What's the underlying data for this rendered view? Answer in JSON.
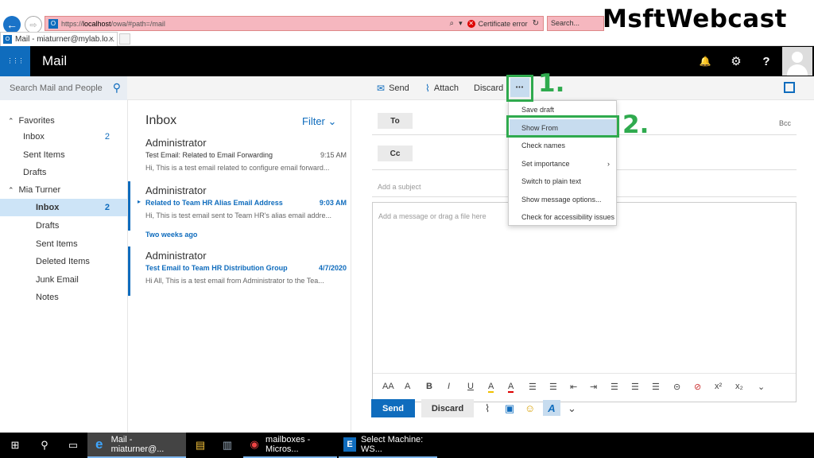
{
  "browser": {
    "back_glyph": "←",
    "fwd_glyph": "⇨",
    "url_prefix": "https://",
    "url_host": "localhost",
    "url_path": "/owa/#path=/mail",
    "search_icon_glyph": "⌕",
    "dropdown_glyph": "▾",
    "cert_glyph": "✕",
    "cert_error": "Certificate error",
    "refresh_glyph": "↻",
    "search_placeholder": "Search...",
    "tab_title": "Mail - miaturner@mylab.lo...",
    "tab_close_glyph": "×",
    "favicon_glyph": "O",
    "brand": "MsftWebcast"
  },
  "header": {
    "waffle_glyph": "⋮⋮⋮",
    "app_name": "Mail",
    "bell_glyph": "🔔",
    "gear_glyph": "⚙",
    "help_glyph": "?"
  },
  "toolbar": {
    "search_placeholder": "Search Mail and People",
    "search_glyph": "⚲",
    "send_glyph": "✉",
    "send": "Send",
    "attach_glyph": "⌇",
    "attach": "Attach",
    "discard": "Discard",
    "more_glyph": "•••"
  },
  "folders": {
    "caret": "⌃",
    "favorites_label": "Favorites",
    "favorites": [
      {
        "label": "Inbox",
        "count": "2"
      },
      {
        "label": "Sent Items",
        "count": ""
      },
      {
        "label": "Drafts",
        "count": ""
      }
    ],
    "account_label": "Mia Turner",
    "account": [
      {
        "label": "Inbox",
        "count": "2"
      },
      {
        "label": "Drafts",
        "count": ""
      },
      {
        "label": "Sent Items",
        "count": ""
      },
      {
        "label": "Deleted Items",
        "count": ""
      },
      {
        "label": "Junk Email",
        "count": ""
      },
      {
        "label": "Notes",
        "count": ""
      }
    ]
  },
  "message_list": {
    "title": "Inbox",
    "filter": "Filter",
    "filter_glyph": "⌄",
    "group_label": "Two weeks ago",
    "unread_glyph": "▸",
    "messages": [
      {
        "from": "Administrator",
        "subject": "Test Email: Related to Email Forwarding",
        "time": "9:15 AM",
        "preview": "Hi, This is a test email related to configure email forward..."
      },
      {
        "from": "Administrator",
        "subject": "Related to Team HR Alias Email Address",
        "time": "9:03 AM",
        "preview": "Hi, This is test email sent to Team HR's alias email addre..."
      },
      {
        "from": "Administrator",
        "subject": "Test Email to Team HR Distribution Group",
        "time": "4/7/2020",
        "preview": "Hi All, This is a test email from Administrator to the Tea..."
      }
    ]
  },
  "compose": {
    "to": "To",
    "cc": "Cc",
    "bcc": "Bcc",
    "subject_placeholder": "Add a subject",
    "body_placeholder": "Add a message or drag a file here",
    "send": "Send",
    "discard": "Discard",
    "attach_glyph": "⌇",
    "image_glyph": "▣",
    "emoji_glyph": "☺",
    "format_glyph": "A",
    "more_glyph": "⌄",
    "format_tools": [
      "AA",
      "A",
      "B",
      "I",
      "U",
      "A",
      "A",
      "☰",
      "☰",
      "⇤",
      "⇥",
      "☰",
      "☰",
      "☰",
      "⊝",
      "⊘",
      "x²",
      "x₂",
      "⌄"
    ]
  },
  "dropdown": {
    "items": [
      "Save draft",
      "Show From",
      "Check names",
      "Set importance",
      "Switch to plain text",
      "Show message options...",
      "Check for accessibility issues"
    ],
    "chevron": "›"
  },
  "annotations": {
    "step1": "1.",
    "step2": "2."
  },
  "taskbar": {
    "start_glyph": "⊞",
    "search_glyph": "⚲",
    "taskview_glyph": "▭",
    "ie_glyph": "e",
    "ie_label": "Mail - miaturner@...",
    "explorer_glyph": "▤",
    "server_glyph": "▥",
    "chrome_glyph": "◉",
    "chrome_label": "mailboxes - Micros...",
    "exchange_glyph": "E",
    "exchange_label": "Select Machine: WS..."
  }
}
